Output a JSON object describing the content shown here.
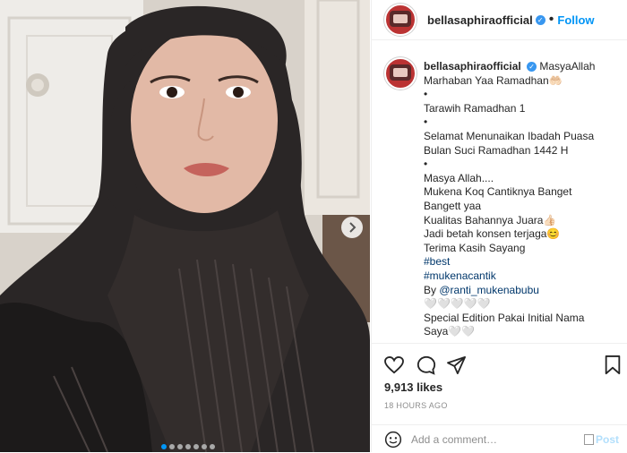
{
  "post": {
    "username": "bellasaphiraofficial",
    "verified": "✓",
    "separator": "•",
    "follow_label": "Follow",
    "caption_lines": [
      "MasyaAllah",
      "Marhaban Yaa Ramadhan🤲🏻",
      "•",
      "Tarawih Ramadhan 1",
      "•",
      "Selamat Menunaikan Ibadah Puasa",
      "Bulan Suci Ramadhan 1442 H",
      "•",
      "Masya Allah....",
      "Mukena Koq Cantiknya Banget",
      "Bangett yaa",
      "Kualitas Bahannya Juara👍🏻",
      "Jadi betah konsen terjaga😊",
      "Terima Kasih Sayang",
      "#best",
      "#mukenacantik",
      "By @ranti_mukenabubu",
      "🤍🤍🤍🤍🤍",
      "Special Edition Pakai Initial Nama",
      "Saya🤍🤍"
    ],
    "likes": "9,913 likes",
    "time": "18 HOURS AGO",
    "comment_placeholder": "Add a comment…",
    "post_label": "Post"
  },
  "icons": {
    "heart": "heart-icon",
    "comment": "comment-icon",
    "share": "share-icon",
    "save": "bookmark-icon",
    "emoji": "emoji-icon",
    "next": "chevron-right-icon"
  },
  "carousel": {
    "slides": 7,
    "active": 1
  },
  "colors": {
    "link": "#00376b",
    "follow": "#0095f6",
    "post_disabled": "#b2dffc",
    "verified": "#3897f0"
  }
}
